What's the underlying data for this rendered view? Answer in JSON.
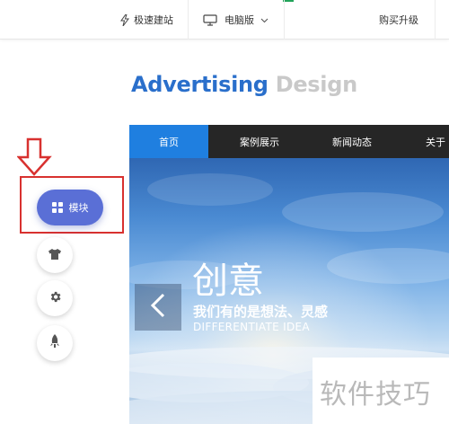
{
  "toolbar": {
    "quick_build_label": "极速建站",
    "device_label": "电脑版",
    "buy_label": "购买升级"
  },
  "heading": {
    "word1": "Advertising",
    "word2": "Design"
  },
  "sidebar": {
    "module_label": "模块",
    "icons": [
      "shirt-icon",
      "gear-icon",
      "rocket-icon"
    ]
  },
  "preview": {
    "nav": [
      "首页",
      "案例展示",
      "新闻动态",
      "关于"
    ],
    "hero_title": "创意",
    "hero_subtitle": "我们有的是想法、灵感",
    "hero_english": "DIFFERENTIATE IDEA"
  },
  "watermark": "软件技巧",
  "colors": {
    "accent_blue": "#2a6fcb",
    "module_button": "#5a6fd6",
    "highlight_red": "#d8312f",
    "nav_active": "#1f7fe0",
    "nav_bg": "#262626"
  }
}
